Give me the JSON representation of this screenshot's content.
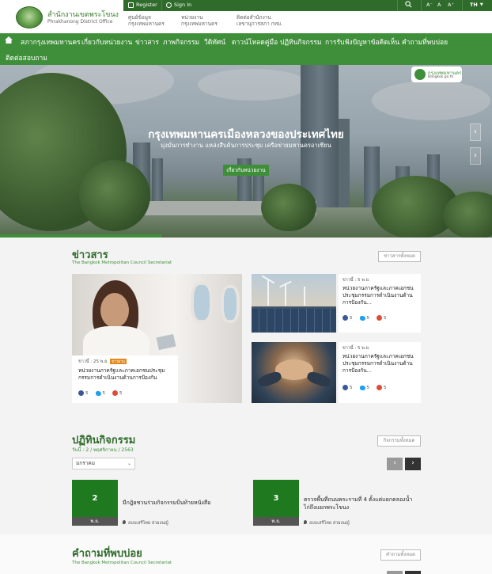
{
  "brand": {
    "title": "สำนักงานเขตพระโขนง",
    "subtitle": "Phrakhanong District Office"
  },
  "toolbar": {
    "register": "Register",
    "signin": "Sign In",
    "font_small": "A⁻",
    "font_normal": "A",
    "font_large": "A⁺",
    "lang": "TH"
  },
  "quick_links": [
    {
      "line1": "ศูนย์ข้อมูล",
      "line2": "กรุงเทพมหานคร"
    },
    {
      "line1": "หน่วยงาน",
      "line2": "กรุงเทพมหานคร"
    },
    {
      "line1": "ติดต่อสำนักงาน",
      "line2": "เลขานุการสภา กทม."
    }
  ],
  "nav": [
    "สภากรุงเทพมหานคร",
    "เกี่ยวกับหน่วยงาน",
    "ข่าวสาร",
    "ภาพกิจกรรม",
    "วีดิทัศน์",
    "ดาวน์โหลดคู่มือ",
    "ปฏิทินกิจกรรม",
    "การรับฟังปัญหาข้อคิดเห็น",
    "คำถามที่พบบ่อย",
    "ติดต่อสอบถาม"
  ],
  "hero": {
    "badge_title": "กรุงเทพมหานคร",
    "badge_sub": "Bangkok.go.th",
    "title": "กรุงเทพมหานครเมืองหลวงของประเทศไทย",
    "subtitle": "มุ่งมั่นการทำงาน แหล่งสืบค้นการประชุม เครือข่ายมหานครอาเซียน",
    "button": "เกี่ยวกับหน่วยงาน",
    "prev": "‹",
    "next": "›",
    "progress": 0.33
  },
  "news": {
    "title": "ข่าวสาร",
    "subtitle": "The Bangkok Metropolitan Council Secretariat",
    "all_button": "ข่าวสารทั้งหมด",
    "featured": {
      "meta": "ข่าวนี้ : 25 พ.ย.",
      "tag": "ข่าวด่วน",
      "text": "หน่วยงานภาครัฐและภาคเอกชนประชุมกรรมการดำเนินงานด้านการป้องกัน",
      "fb": "5",
      "tw": "5",
      "gp": "5"
    },
    "items": [
      {
        "meta": "ข่าวนี้ : 5 พ.ย.",
        "text": "หน่วยงานภาครัฐและภาคเอกชนประชุมกรรมการดำเนินงานด้านการป้องกัน...",
        "fb": "5",
        "tw": "5",
        "gp": "5"
      },
      {
        "meta": "ข่าวนี้ : 5 พ.ย.",
        "text": "หน่วยงานภาครัฐและภาคเอกชนประชุมกรรมการดำเนินงานด้านการป้องกัน...",
        "fb": "5",
        "tw": "5",
        "gp": "5"
      }
    ]
  },
  "activities": {
    "title": "ปฏิทินกิจกรรม",
    "date_label": "วันนี้ : 2 / พฤศจิกายน / 2563",
    "all_button": "กิจกรรมทั้งหมด",
    "month_select": "มกราคม",
    "prev": "‹",
    "next": "›",
    "items": [
      {
        "day": "2",
        "month": "พ.ย.",
        "title": "มีกฎิยชวนร่วมกิจกรรมปั่นท้ายหนังสือ",
        "location": "อบบเสรีไทย ส่วยงนญ์"
      },
      {
        "day": "3",
        "month": "พ.ย.",
        "title": "ตรวจพื้นที่ถนนพระรามที่ 4 ตั้งแต่แยกคลองน้ำไก่ถึงแยกพระโขนง",
        "location": "อบบเสรีไทย ส่วยงนญ์"
      }
    ]
  },
  "faq": {
    "title": "คำถามที่พบบ่อย",
    "subtitle": "The Bangkok Metropolitan Council Secretariat",
    "all_button": "คำถามทั้งหมด"
  }
}
